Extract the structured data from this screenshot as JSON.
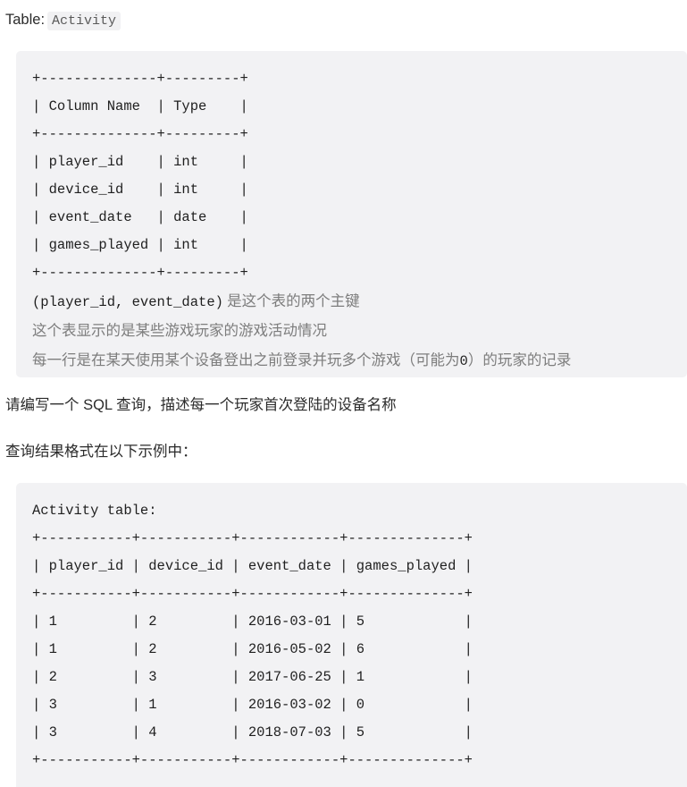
{
  "intro": {
    "label": "Table:",
    "table_name": "Activity"
  },
  "schema_block": {
    "lines": [
      "+--------------+---------+",
      "| Column Name  | Type    |",
      "+--------------+---------+",
      "| player_id    | int     |",
      "| device_id    | int     |",
      "| event_date   | date    |",
      "| games_played | int     |",
      "+--------------+---------+"
    ],
    "notes": [
      {
        "mono": "(player_id, event_date)",
        "text": " 是这个表的两个主键"
      },
      {
        "mono": "",
        "text": "这个表显示的是某些游戏玩家的游戏活动情况"
      },
      {
        "mono": "",
        "text": "每一行是在某天使用某个设备登出之前登录并玩多个游戏（可能为",
        "mono_tail": "0",
        "text_tail": "）的玩家的记录"
      }
    ]
  },
  "question": "请编写一个 SQL 查询，描述每一个玩家首次登陆的设备名称",
  "format_note": "查询结果格式在以下示例中：",
  "example_block": {
    "title": "Activity table:",
    "separator": "+-----------+-----------+------------+--------------+",
    "header": "| player_id | device_id | event_date | games_played |",
    "rows": [
      "| 1         | 2         | 2016-03-01 | 5            |",
      "| 1         | 2         | 2016-05-02 | 6            |",
      "| 2         | 3         | 2017-06-25 | 1            |",
      "| 3         | 1         | 2016-03-02 | 0            |",
      "| 3         | 4         | 2018-07-03 | 5            |"
    ],
    "columns": [
      "player_id",
      "device_id",
      "event_date",
      "games_played"
    ],
    "data": [
      {
        "player_id": 1,
        "device_id": 2,
        "event_date": "2016-03-01",
        "games_played": 5
      },
      {
        "player_id": 1,
        "device_id": 2,
        "event_date": "2016-05-02",
        "games_played": 6
      },
      {
        "player_id": 2,
        "device_id": 3,
        "event_date": "2017-06-25",
        "games_played": 1
      },
      {
        "player_id": 3,
        "device_id": 1,
        "event_date": "2016-03-02",
        "games_played": 0
      },
      {
        "player_id": 3,
        "device_id": 4,
        "event_date": "2018-07-03",
        "games_played": 5
      }
    ]
  },
  "colors": {
    "page_background": "#ffffff",
    "code_background": "#f2f2f4",
    "inline_code_background": "#f1f1f3",
    "body_text": "#2b2b2b",
    "muted_text": "#7d7d7d",
    "code_text": "#1f1f1f"
  }
}
